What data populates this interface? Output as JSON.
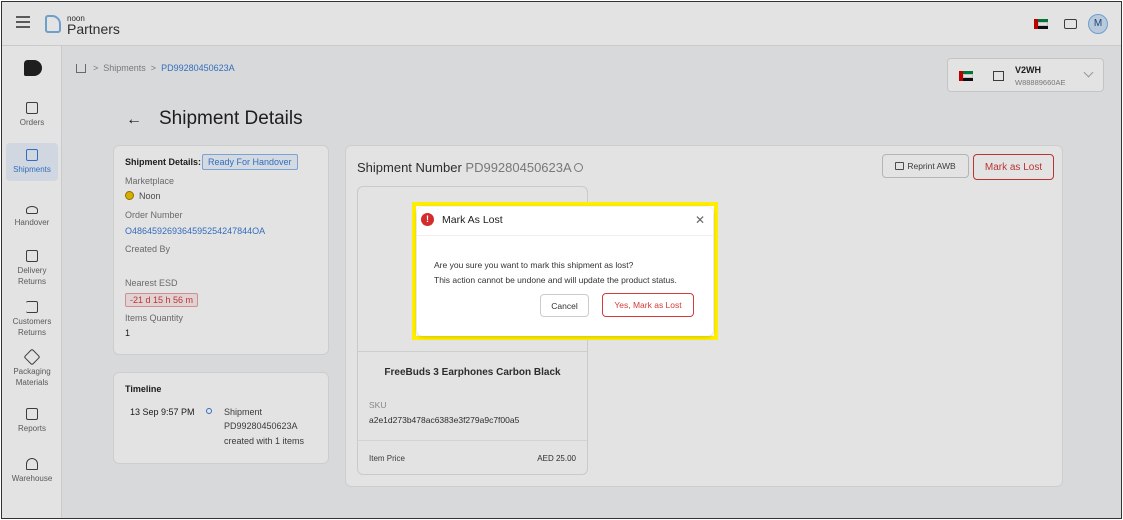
{
  "topbar": {
    "brand_small": "noon",
    "brand_name": "Partners"
  },
  "sidebar": {
    "items": [
      {
        "label": "Orders",
        "icon": "orders-icon"
      },
      {
        "label": "Shipments",
        "icon": "truck-icon"
      },
      {
        "label": "Handover",
        "icon": "handshake-icon"
      },
      {
        "label": "Delivery Returns",
        "icon": "return-box-icon"
      },
      {
        "label": "Customers Returns",
        "icon": "return-arrow-icon"
      },
      {
        "label": "Packaging Materials",
        "icon": "package-icon"
      },
      {
        "label": "Reports",
        "icon": "report-icon"
      },
      {
        "label": "Warehouse",
        "icon": "warehouse-icon"
      }
    ]
  },
  "breadcrumb": {
    "items": [
      "Shipments",
      "PD99280450623A"
    ]
  },
  "selector": {
    "code": "V2WH",
    "id": "W88889660AE"
  },
  "page": {
    "title": "Shipment Details"
  },
  "details": {
    "label": "Shipment Details:",
    "status": "Ready For Handover",
    "marketplace_label": "Marketplace",
    "marketplace_value": "Noon",
    "order_number_label": "Order Number",
    "order_number_value": "O486459269364595254247844OA",
    "created_by_label": "Created By",
    "nearest_esd_label": "Nearest ESD",
    "nearest_esd_value": "-21 d 15 h 56 m",
    "items_quantity_label": "Items Quantity",
    "items_quantity_value": "1"
  },
  "timeline": {
    "title": "Timeline",
    "date": "13 Sep 9:57 PM",
    "event_lines": [
      "Shipment",
      "PD99280450623A",
      "created with 1 items"
    ]
  },
  "shipment": {
    "number_label": "Shipment Number",
    "number_value": "PD99280450623A",
    "reprint_label": "Reprint AWB",
    "mark_lost_label": "Mark as Lost",
    "product": {
      "name": "FreeBuds 3 Earphones Carbon Black",
      "sku_label": "SKU",
      "sku_value": "a2e1d273b478ac6383e3f279a9c7f00a5",
      "price_label": "Item Price",
      "price_value": "AED 25.00"
    }
  },
  "modal": {
    "title": "Mark As Lost",
    "message_line1": "Are you sure you want to mark this shipment as lost?",
    "message_line2": "This action cannot be undone and will update the product status.",
    "cancel_label": "Cancel",
    "confirm_label": "Yes, Mark as Lost"
  },
  "colors": {
    "accent": "#3a7bd5",
    "danger": "#d43a3a",
    "highlight": "#ffee00"
  }
}
